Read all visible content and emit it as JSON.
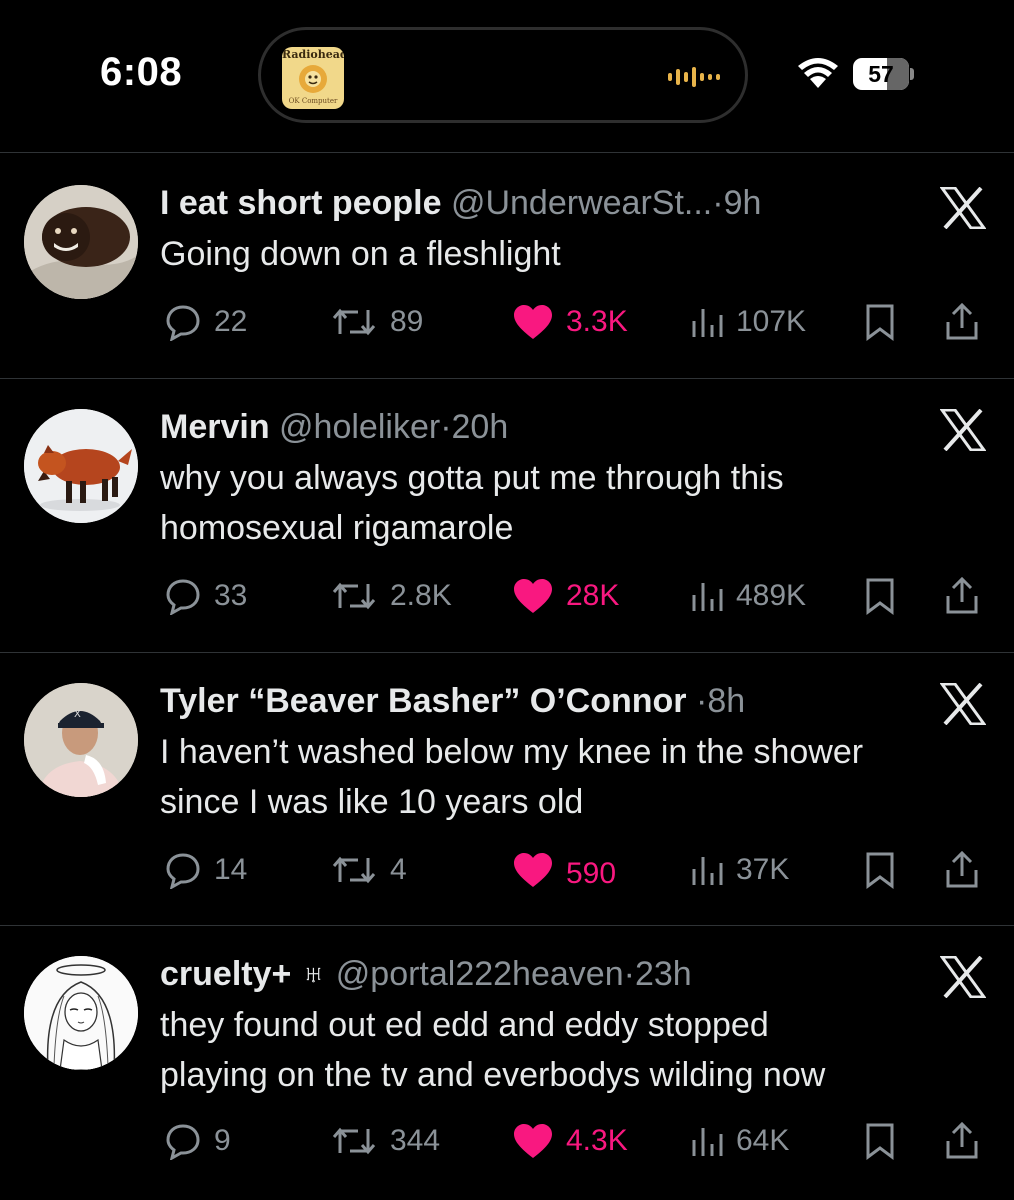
{
  "status_bar": {
    "time": "6:08",
    "battery": "57",
    "album_art": {
      "title": "Radiohead",
      "subtitle": "OK Computer"
    },
    "accent_waveform": "#e8b44a"
  },
  "colors": {
    "background": "#000000",
    "like": "#f91880",
    "muted": "#8b9298",
    "text": "#e7e9ea"
  },
  "tweets": [
    {
      "name": "I eat short people",
      "handle": "@UnderwearSt...",
      "dot": "·",
      "ago": "9h",
      "text": [
        "Going down on a fleshlight"
      ],
      "replies": "22",
      "retweets": "89",
      "likes": "3.3K",
      "views": "107K",
      "avatar_icon": "dark-blob-face-avatar"
    },
    {
      "name": "Mervin",
      "handle": "@holeliker",
      "dot": "·",
      "ago": "20h",
      "text": [
        "why you always gotta put me through this",
        "homosexual rigamarole"
      ],
      "replies": "33",
      "retweets": "2.8K",
      "likes": "28K",
      "views": "489K",
      "avatar_icon": "orange-animal-toy-avatar"
    },
    {
      "name": "Tyler “Beaver Basher” O’Connor",
      "handle": "",
      "dot": "·",
      "ago": "8h",
      "text": [
        "I haven’t washed below my knee in the shower",
        "since I was like 10 years old"
      ],
      "replies": "14",
      "retweets": "4",
      "likes": "590",
      "views": "37K",
      "avatar_icon": "man-in-cap-avatar"
    },
    {
      "name": "cruelty+ ♅",
      "handle": "@portal222heaven",
      "dot": "·",
      "ago": "23h",
      "text": [
        "they found out ed edd and eddy stopped",
        "playing on the tv and everbodys wilding now"
      ],
      "replies": "9",
      "retweets": "344",
      "likes": "4.3K",
      "views": "64K",
      "avatar_icon": "anime-angel-sketch-avatar"
    }
  ]
}
